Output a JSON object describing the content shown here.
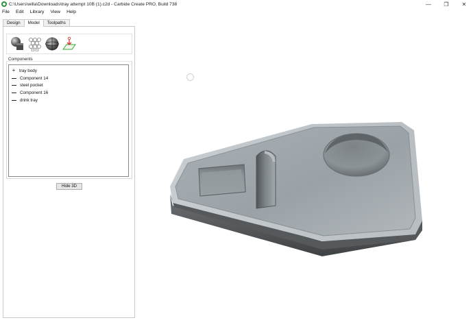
{
  "window": {
    "title": "C:\\Users\\willa\\Downloads\\tray attempt 10B (1).c2d - Carbide Create PRO, Build 738",
    "controls": {
      "minimize": "—",
      "maximize": "❐",
      "close": "✕"
    }
  },
  "menu": [
    "File",
    "Edit",
    "Library",
    "View",
    "Help"
  ],
  "tabs": [
    "Design",
    "Model",
    "Toolpaths"
  ],
  "tools": [
    "shape-tool-icon",
    "texture-tool-icon",
    "sphere-tool-icon",
    "import-model-icon"
  ],
  "components": {
    "label": "Components",
    "items": [
      {
        "name": "tray body",
        "mark": "+"
      },
      {
        "name": "Component 14",
        "mark": "—"
      },
      {
        "name": "steel pocket",
        "mark": "—"
      },
      {
        "name": "Component 16",
        "mark": "—"
      },
      {
        "name": "drink tray",
        "mark": "—"
      }
    ]
  },
  "hide3d_label": "Hide 3D"
}
